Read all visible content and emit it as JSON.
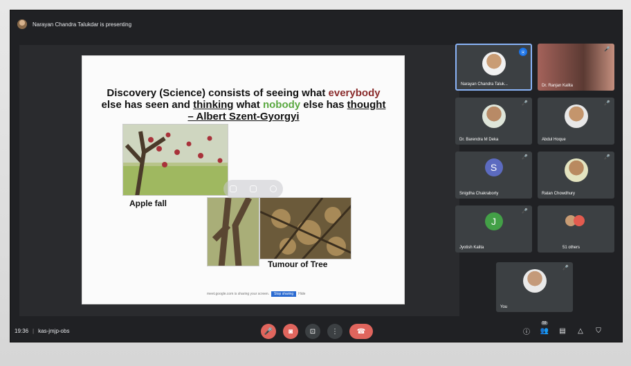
{
  "topbar": {
    "presenting_text": "Narayan Chandra Talukdar is presenting"
  },
  "slide": {
    "quote_part1": "Discovery (Science) consists of seeing what ",
    "quote_word_everybody": "everybody",
    "quote_part2": "else has seen and ",
    "quote_word_thinking": "thinking",
    "quote_part3": " what ",
    "quote_word_nobody": "nobody",
    "quote_part4": " else has ",
    "quote_word_thought": "thought",
    "author": "– Albert Szent-Gyorgyi",
    "caption_apple": "Apple fall",
    "caption_tumour": "Tumour of Tree",
    "footer_text": "meet.google.com is sharing your screen.",
    "footer_stop": "Stop sharing",
    "footer_hide": "Hide"
  },
  "participants": [
    {
      "name": "Narayan Chandra Taluk...",
      "type": "photo",
      "speaking": true
    },
    {
      "name": "Dr. Ranjan Kalita",
      "type": "video",
      "muted": true
    },
    {
      "name": "Dr. Barendra M Deka",
      "type": "photo",
      "muted": true
    },
    {
      "name": "Abdul Hoque",
      "type": "photo",
      "muted": true
    },
    {
      "name": "Snigdha Chakraborty",
      "type": "initial",
      "initial": "S",
      "color": "#5c6bc0",
      "muted": true
    },
    {
      "name": "Ratan Chowdhury",
      "type": "photo",
      "muted": true
    },
    {
      "name": "Jyotish Kalita",
      "type": "initial",
      "initial": "J",
      "color": "#43a047",
      "muted": true
    },
    {
      "name": "51 others",
      "type": "group"
    },
    {
      "name": "You",
      "type": "photo",
      "muted": true
    }
  ],
  "bottombar": {
    "time": "19:36",
    "meeting_code": "kas-jmjp-obs",
    "participant_count": "59"
  },
  "icons": {
    "mic": "mic-off-icon",
    "camera": "camera-off-icon",
    "present": "present-icon",
    "more": "more-vert-icon",
    "leave": "call-end-icon"
  }
}
